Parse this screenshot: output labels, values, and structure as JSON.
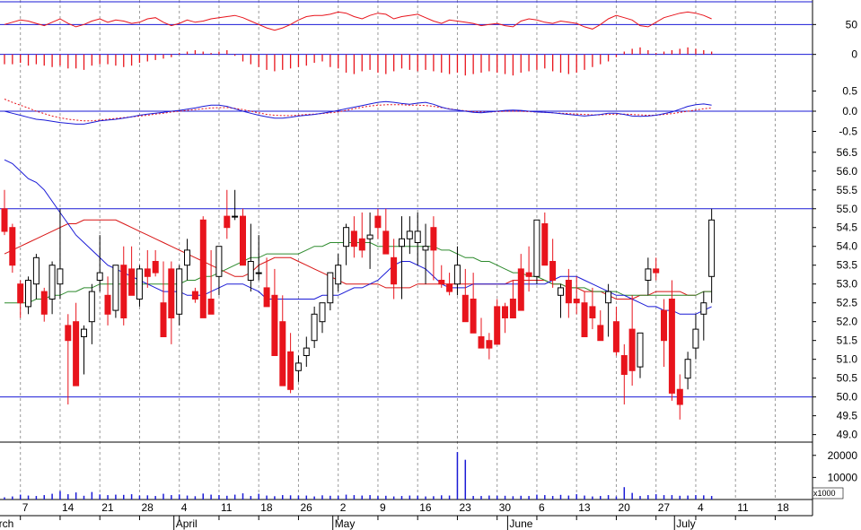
{
  "colors": {
    "up": "#ffffff",
    "down": "#e8141c",
    "down_black": "#000000",
    "rsi": "#e8141c",
    "macd_line": "#1a1ad6",
    "macd_signal": "#e8141c",
    "ma_short": "#1a1ad6",
    "ma_mid": "#2e8b2e",
    "ma_long": "#d81414",
    "ref_line": "#1a1ad6",
    "volume": "#1a1ad6",
    "grid": "#9a9a9a"
  },
  "x_axis": {
    "ticks": [
      "7",
      "14",
      "21",
      "28",
      "4",
      "11",
      "18",
      "26",
      "2",
      "9",
      "16",
      "23",
      "30",
      "6",
      "13",
      "20",
      "27",
      "4",
      "11",
      "18"
    ],
    "month_labels": [
      "March",
      "April",
      "May",
      "June",
      "July"
    ]
  },
  "panels": {
    "rsi": {
      "ticks": [
        "50"
      ]
    },
    "histogram": {
      "ticks": [
        "0"
      ]
    },
    "macd": {
      "ticks": [
        "0.5",
        "0.0",
        "-0.5"
      ]
    },
    "price": {
      "ticks": [
        "56.5",
        "56.0",
        "55.5",
        "55.0",
        "54.5",
        "54.0",
        "53.5",
        "53.0",
        "52.5",
        "52.0",
        "51.5",
        "51.0",
        "50.5",
        "50.0",
        "49.5",
        "49.0"
      ]
    },
    "volume": {
      "ticks": [
        "20000",
        "10000"
      ],
      "multiplier_label": "x1000"
    }
  },
  "chart_data": {
    "type": "candlestick",
    "dates": [
      "Mar 5",
      "Mar 6",
      "Mar 7",
      "Mar 8",
      "Mar 9",
      "Mar 12",
      "Mar 13",
      "Mar 14",
      "Mar 15",
      "Mar 16",
      "Mar 19",
      "Mar 20",
      "Mar 21",
      "Mar 22",
      "Mar 23",
      "Mar 26",
      "Mar 27",
      "Mar 28",
      "Mar 29",
      "Mar 30",
      "Apr 2",
      "Apr 3",
      "Apr 4",
      "Apr 5",
      "Apr 6",
      "Apr 9",
      "Apr 10",
      "Apr 11",
      "Apr 12",
      "Apr 13",
      "Apr 16",
      "Apr 17",
      "Apr 18",
      "Apr 19",
      "Apr 20",
      "Apr 23",
      "Apr 24",
      "Apr 25",
      "Apr 26",
      "Apr 27",
      "Apr 30",
      "May 1",
      "May 2",
      "May 3",
      "May 4",
      "May 7",
      "May 8",
      "May 9",
      "May 10",
      "May 11",
      "May 14",
      "May 15",
      "May 16",
      "May 17",
      "May 18",
      "May 21",
      "May 22",
      "May 23",
      "May 24",
      "May 25",
      "May 28",
      "May 29",
      "May 30",
      "May 31",
      "Jun 1",
      "Jun 4",
      "Jun 5",
      "Jun 6",
      "Jun 7",
      "Jun 8",
      "Jun 11",
      "Jun 12",
      "Jun 13",
      "Jun 14",
      "Jun 15",
      "Jun 18",
      "Jun 19",
      "Jun 20",
      "Jun 21",
      "Jun 22",
      "Jun 25",
      "Jun 26",
      "Jun 27",
      "Jun 28",
      "Jun 29",
      "Jul 2",
      "Jul 3",
      "Jul 4",
      "Jul 5",
      "Jul 6"
    ],
    "ohlc": [
      [
        55.0,
        55.5,
        54.3,
        54.4
      ],
      [
        54.5,
        54.6,
        53.3,
        53.5
      ],
      [
        53.0,
        53.1,
        52.1,
        52.5
      ],
      [
        52.4,
        53.2,
        52.2,
        53.1
      ],
      [
        53.0,
        53.8,
        52.6,
        53.7
      ],
      [
        52.8,
        52.9,
        52.0,
        52.2
      ],
      [
        52.6,
        53.6,
        52.2,
        53.5
      ],
      [
        53.0,
        55.0,
        52.6,
        53.4
      ],
      [
        51.9,
        52.2,
        49.8,
        51.5
      ],
      [
        52.0,
        52.5,
        50.8,
        50.3
      ],
      [
        51.6,
        51.9,
        50.6,
        51.8
      ],
      [
        52.0,
        53.0,
        51.4,
        52.8
      ],
      [
        53.1,
        54.3,
        52.8,
        53.3
      ],
      [
        52.7,
        53.2,
        51.9,
        52.2
      ],
      [
        52.3,
        53.4,
        52.1,
        53.5
      ],
      [
        53.5,
        54.0,
        51.9,
        52.1
      ],
      [
        53.4,
        54.0,
        52.9,
        52.7
      ],
      [
        52.6,
        53.5,
        52.4,
        53.4
      ],
      [
        53.4,
        53.9,
        52.9,
        53.2
      ],
      [
        53.6,
        53.9,
        53.2,
        53.3
      ],
      [
        52.5,
        53.6,
        52.3,
        51.6
      ],
      [
        53.4,
        53.6,
        51.4,
        52.1
      ],
      [
        52.2,
        53.5,
        51.9,
        53.4
      ],
      [
        53.5,
        54.2,
        53.1,
        53.9
      ],
      [
        52.8,
        52.9,
        52.5,
        52.6
      ],
      [
        54.7,
        54.8,
        53.2,
        52.1
      ],
      [
        52.6,
        53.9,
        52.3,
        52.2
      ],
      [
        53.2,
        54.0,
        52.7,
        54.0
      ],
      [
        54.8,
        55.5,
        54.2,
        54.5
      ],
      [
        54.8,
        55.5,
        54.7,
        54.8
      ],
      [
        54.8,
        55.0,
        53.7,
        53.5
      ],
      [
        53.1,
        54.6,
        52.8,
        53.6
      ],
      [
        53.3,
        54.3,
        53.1,
        53.3
      ],
      [
        52.9,
        53.7,
        52.7,
        52.4
      ],
      [
        52.7,
        53.4,
        52.0,
        51.1
      ],
      [
        52.0,
        52.7,
        51.0,
        50.3
      ],
      [
        51.2,
        51.7,
        50.1,
        50.2
      ],
      [
        50.7,
        51.1,
        50.4,
        50.9
      ],
      [
        51.1,
        51.6,
        50.8,
        51.3
      ],
      [
        51.5,
        52.4,
        51.3,
        52.2
      ],
      [
        52.0,
        52.5,
        51.7,
        52.5
      ],
      [
        52.5,
        53.0,
        52.3,
        53.3
      ],
      [
        53.0,
        53.8,
        52.8,
        53.5
      ],
      [
        54.0,
        54.6,
        53.5,
        54.5
      ],
      [
        54.4,
        54.8,
        53.7,
        54.0
      ],
      [
        54.2,
        54.9,
        53.7,
        53.9
      ],
      [
        54.2,
        54.9,
        53.4,
        54.3
      ],
      [
        54.8,
        55.0,
        54.2,
        54.5
      ],
      [
        54.4,
        55.0,
        54.0,
        53.8
      ],
      [
        53.7,
        54.2,
        52.6,
        53.0
      ],
      [
        54.0,
        54.8,
        52.6,
        54.2
      ],
      [
        54.2,
        54.8,
        53.8,
        54.4
      ],
      [
        54.1,
        54.9,
        53.5,
        54.4
      ],
      [
        53.9,
        54.6,
        53.0,
        54.0
      ],
      [
        54.5,
        54.8,
        53.1,
        53.9
      ],
      [
        53.1,
        53.5,
        52.9,
        53.0
      ],
      [
        53.0,
        53.3,
        52.7,
        52.8
      ],
      [
        53.0,
        54.0,
        52.7,
        53.5
      ],
      [
        52.7,
        53.4,
        52.3,
        52.0
      ],
      [
        52.6,
        53.3,
        52.2,
        51.7
      ],
      [
        51.6,
        52.1,
        51.3,
        51.3
      ],
      [
        51.5,
        51.7,
        51.0,
        51.3
      ],
      [
        52.4,
        52.6,
        52.0,
        51.4
      ],
      [
        52.4,
        52.5,
        51.7,
        52.1
      ],
      [
        52.6,
        53.1,
        52.1,
        52.1
      ],
      [
        53.4,
        53.8,
        52.5,
        52.3
      ],
      [
        53.3,
        54.0,
        52.8,
        53.2
      ],
      [
        53.2,
        54.7,
        53.0,
        54.7
      ],
      [
        54.6,
        54.9,
        53.8,
        53.5
      ],
      [
        53.6,
        54.2,
        52.9,
        53.1
      ],
      [
        52.7,
        53.0,
        52.1,
        52.9
      ],
      [
        53.1,
        53.4,
        52.1,
        52.5
      ],
      [
        52.6,
        53.2,
        52.2,
        52.5
      ],
      [
        52.5,
        52.8,
        51.6,
        51.6
      ],
      [
        52.4,
        52.9,
        51.8,
        52.1
      ],
      [
        51.9,
        52.3,
        51.5,
        51.5
      ],
      [
        52.5,
        53.0,
        51.6,
        52.8
      ],
      [
        52.0,
        52.4,
        51.1,
        51.2
      ],
      [
        51.1,
        51.4,
        49.8,
        50.6
      ],
      [
        51.8,
        52.7,
        50.3,
        50.7
      ],
      [
        50.8,
        51.5,
        50.5,
        51.7
      ],
      [
        53.1,
        53.7,
        52.7,
        53.4
      ],
      [
        53.4,
        53.7,
        53.1,
        53.3
      ],
      [
        52.3,
        52.6,
        50.8,
        51.5
      ],
      [
        52.6,
        53.1,
        49.9,
        50.1
      ],
      [
        50.2,
        50.6,
        49.4,
        49.8
      ],
      [
        50.5,
        51.2,
        50.2,
        51.0
      ],
      [
        51.3,
        52.2,
        51.0,
        51.8
      ],
      [
        52.2,
        52.8,
        51.5,
        52.5
      ],
      [
        53.2,
        55.0,
        52.5,
        54.7
      ]
    ],
    "rsi": [
      50,
      52,
      54,
      53,
      51,
      49,
      52,
      55,
      51,
      48,
      50,
      53,
      55,
      52,
      54,
      53,
      51,
      52,
      55,
      56,
      52,
      49,
      51,
      54,
      52,
      53,
      55,
      56,
      57,
      58,
      56,
      53,
      50,
      47,
      45,
      47,
      50,
      54,
      57,
      58,
      58,
      59,
      61,
      60,
      57,
      55,
      58,
      60,
      59,
      55,
      57,
      58,
      59,
      56,
      53,
      51,
      54,
      53,
      52,
      51,
      49,
      50,
      51,
      49,
      48,
      53,
      55,
      54,
      52,
      51,
      53,
      52,
      51,
      48,
      46,
      50,
      55,
      58,
      56,
      54,
      49,
      48,
      52,
      56,
      58,
      60,
      61,
      60,
      58,
      55
    ],
    "histogram": [
      -0.07,
      -0.07,
      -0.06,
      -0.08,
      -0.07,
      -0.08,
      -0.09,
      -0.08,
      -0.1,
      -0.1,
      -0.11,
      -0.08,
      -0.07,
      -0.07,
      -0.08,
      -0.09,
      -0.08,
      -0.06,
      -0.05,
      -0.04,
      -0.03,
      -0.02,
      0.01,
      0.02,
      0.03,
      0.02,
      0.01,
      0.02,
      0.03,
      -0.01,
      -0.05,
      -0.07,
      -0.09,
      -0.11,
      -0.12,
      -0.11,
      -0.1,
      -0.09,
      -0.08,
      -0.06,
      -0.05,
      -0.09,
      -0.1,
      -0.13,
      -0.14,
      -0.12,
      -0.11,
      -0.13,
      -0.14,
      -0.12,
      -0.1,
      -0.11,
      -0.12,
      -0.11,
      -0.12,
      -0.13,
      -0.14,
      -0.13,
      -0.15,
      -0.14,
      -0.13,
      -0.12,
      -0.13,
      -0.14,
      -0.15,
      -0.13,
      -0.12,
      -0.11,
      -0.1,
      -0.12,
      -0.13,
      -0.14,
      -0.13,
      -0.11,
      -0.09,
      -0.07,
      -0.05,
      -0.02,
      0.02,
      0.04,
      0.05,
      0.03,
      0.01,
      0.02,
      0.03,
      0.04,
      0.05,
      0.04,
      0.03,
      0.02
    ],
    "macd": [
      0.0,
      -0.05,
      -0.1,
      -0.15,
      -0.2,
      -0.22,
      -0.25,
      -0.28,
      -0.3,
      -0.32,
      -0.32,
      -0.28,
      -0.24,
      -0.22,
      -0.2,
      -0.17,
      -0.14,
      -0.1,
      -0.07,
      -0.05,
      -0.03,
      0.0,
      0.02,
      0.05,
      0.08,
      0.12,
      0.15,
      0.15,
      0.12,
      0.06,
      0.0,
      -0.05,
      -0.1,
      -0.14,
      -0.17,
      -0.17,
      -0.15,
      -0.12,
      -0.1,
      -0.08,
      -0.05,
      -0.02,
      0.02,
      0.06,
      0.1,
      0.14,
      0.18,
      0.22,
      0.24,
      0.22,
      0.19,
      0.17,
      0.2,
      0.22,
      0.17,
      0.1,
      0.05,
      0.03,
      0.0,
      -0.03,
      -0.04,
      -0.02,
      0.0,
      0.02,
      0.03,
      0.02,
      0.0,
      -0.02,
      -0.03,
      -0.04,
      -0.06,
      -0.08,
      -0.1,
      -0.12,
      -0.1,
      -0.08,
      -0.05,
      -0.05,
      -0.08,
      -0.12,
      -0.13,
      -0.12,
      -0.1,
      -0.06,
      -0.02,
      0.05,
      0.12,
      0.16,
      0.18,
      0.15
    ],
    "macd_signal": [
      0.3,
      0.22,
      0.15,
      0.08,
      0.0,
      -0.06,
      -0.12,
      -0.16,
      -0.2,
      -0.22,
      -0.24,
      -0.24,
      -0.22,
      -0.2,
      -0.18,
      -0.16,
      -0.14,
      -0.12,
      -0.1,
      -0.07,
      -0.05,
      -0.02,
      0.0,
      0.02,
      0.04,
      0.06,
      0.08,
      0.09,
      0.09,
      0.07,
      0.04,
      0.0,
      -0.04,
      -0.08,
      -0.1,
      -0.11,
      -0.11,
      -0.1,
      -0.08,
      -0.07,
      -0.06,
      -0.04,
      -0.02,
      0.02,
      0.06,
      0.1,
      0.13,
      0.15,
      0.16,
      0.16,
      0.16,
      0.15,
      0.15,
      0.14,
      0.12,
      0.09,
      0.06,
      0.03,
      0.01,
      -0.01,
      -0.02,
      -0.02,
      -0.01,
      0.0,
      0.0,
      0.0,
      -0.01,
      -0.02,
      -0.03,
      -0.04,
      -0.05,
      -0.06,
      -0.07,
      -0.08,
      -0.09,
      -0.09,
      -0.08,
      -0.07,
      -0.07,
      -0.08,
      -0.09,
      -0.1,
      -0.1,
      -0.08,
      -0.06,
      -0.03,
      0.0,
      0.03,
      0.06,
      0.08
    ],
    "ma_short": [
      56.3,
      56.2,
      56.0,
      55.8,
      55.7,
      55.5,
      55.2,
      54.9,
      54.6,
      54.3,
      54.1,
      53.9,
      53.7,
      53.5,
      53.4,
      53.3,
      53.2,
      53.1,
      53.0,
      52.9,
      52.8,
      52.8,
      52.8,
      52.7,
      52.7,
      52.7,
      52.8,
      52.9,
      53.0,
      53.0,
      53.0,
      52.9,
      52.8,
      52.6,
      52.6,
      52.6,
      52.6,
      52.6,
      52.6,
      52.6,
      52.7,
      52.7,
      52.7,
      52.8,
      52.9,
      52.9,
      53.0,
      53.1,
      53.3,
      53.5,
      53.6,
      53.6,
      53.5,
      53.4,
      53.2,
      53.0,
      52.9,
      52.9,
      52.9,
      53.0,
      53.0,
      53.0,
      53.0,
      53.0,
      53.0,
      53.0,
      53.0,
      53.0,
      53.0,
      53.1,
      53.2,
      53.2,
      53.2,
      53.1,
      53.0,
      52.9,
      52.8,
      52.7,
      52.7,
      52.6,
      52.5,
      52.4,
      52.4,
      52.3,
      52.3,
      52.2,
      52.2,
      52.2,
      52.3,
      52.4
    ],
    "ma_mid": [
      52.5,
      52.5,
      52.5,
      52.5,
      52.6,
      52.6,
      52.7,
      52.7,
      52.8,
      52.8,
      52.9,
      52.9,
      53.0,
      53.0,
      53.0,
      53.0,
      53.0,
      53.0,
      53.0,
      53.0,
      53.0,
      53.0,
      53.0,
      53.1,
      53.1,
      53.2,
      53.2,
      53.3,
      53.4,
      53.5,
      53.6,
      53.7,
      53.7,
      53.8,
      53.8,
      53.8,
      53.8,
      53.8,
      53.9,
      54.0,
      54.0,
      54.1,
      54.1,
      54.1,
      54.1,
      54.1,
      54.1,
      54.0,
      54.0,
      54.0,
      54.0,
      54.0,
      54.0,
      54.0,
      54.0,
      53.9,
      53.9,
      53.8,
      53.7,
      53.7,
      53.6,
      53.6,
      53.5,
      53.4,
      53.3,
      53.3,
      53.2,
      53.2,
      53.1,
      53.0,
      53.0,
      52.9,
      52.9,
      52.9,
      52.8,
      52.8,
      52.8,
      52.8,
      52.7,
      52.7,
      52.7,
      52.7,
      52.7,
      52.7,
      52.7,
      52.7,
      52.7,
      52.7,
      52.8,
      52.8
    ],
    "ma_long": [
      53.8,
      53.9,
      54.0,
      54.1,
      54.2,
      54.3,
      54.4,
      54.5,
      54.6,
      54.6,
      54.7,
      54.7,
      54.7,
      54.7,
      54.7,
      54.6,
      54.5,
      54.4,
      54.3,
      54.2,
      54.1,
      54.0,
      53.9,
      53.8,
      53.7,
      53.6,
      53.5,
      53.4,
      53.3,
      53.2,
      53.2,
      53.3,
      53.5,
      53.6,
      53.7,
      53.7,
      53.7,
      53.6,
      53.5,
      53.4,
      53.3,
      53.2,
      53.1,
      53.0,
      53.0,
      53.0,
      53.0,
      53.0,
      52.9,
      52.9,
      52.9,
      52.9,
      53.0,
      53.0,
      53.0,
      53.0,
      53.0,
      53.0,
      53.0,
      53.0,
      53.0,
      53.0,
      53.0,
      53.0,
      53.1,
      53.1,
      53.1,
      53.1,
      53.1,
      53.0,
      53.0,
      52.9,
      52.9,
      52.8,
      52.8,
      52.8,
      52.7,
      52.6,
      52.6,
      52.6,
      52.7,
      52.7,
      52.8,
      52.8,
      52.8,
      52.8,
      52.7,
      52.7,
      52.8,
      52.8
    ],
    "volume": [
      1000,
      1400,
      2200,
      1800,
      1600,
      2000,
      2600,
      3800,
      2400,
      3200,
      1700,
      3400,
      2300,
      2000,
      2200,
      2100,
      2400,
      1800,
      1900,
      1600,
      2600,
      2000,
      2300,
      1800,
      1500,
      2700,
      2200,
      2000,
      1700,
      2200,
      2800,
      1600,
      2600,
      1800,
      1500,
      2000,
      1900,
      1800,
      1800,
      1400,
      1900,
      1700,
      1700,
      2200,
      2000,
      1800,
      2000,
      1600,
      1700,
      1400,
      1600,
      1800,
      1700,
      1400,
      1500,
      1900,
      1800,
      21500,
      18000,
      1600,
      1600,
      1800,
      1700,
      1700,
      1500,
      1700,
      1600,
      2200,
      2000,
      1600,
      2100,
      1800,
      2400,
      1800,
      1400,
      1600,
      2000,
      1400,
      5600,
      3000,
      1600,
      2000,
      2400,
      2000,
      2000,
      1700,
      1800,
      2000,
      1900,
      1600
    ],
    "price_ref_lines": [
      55.0,
      50.0
    ],
    "rsi_ref_lines": [
      70,
      50
    ],
    "macd_ref_lines": [
      0.0
    ],
    "axes": {
      "price": [
        48.8,
        56.9
      ],
      "rsi": [
        40,
        70
      ],
      "histogram": [
        -0.2,
        0.1
      ],
      "macd": [
        -0.6,
        0.6
      ],
      "volume": [
        0,
        26000
      ]
    }
  }
}
